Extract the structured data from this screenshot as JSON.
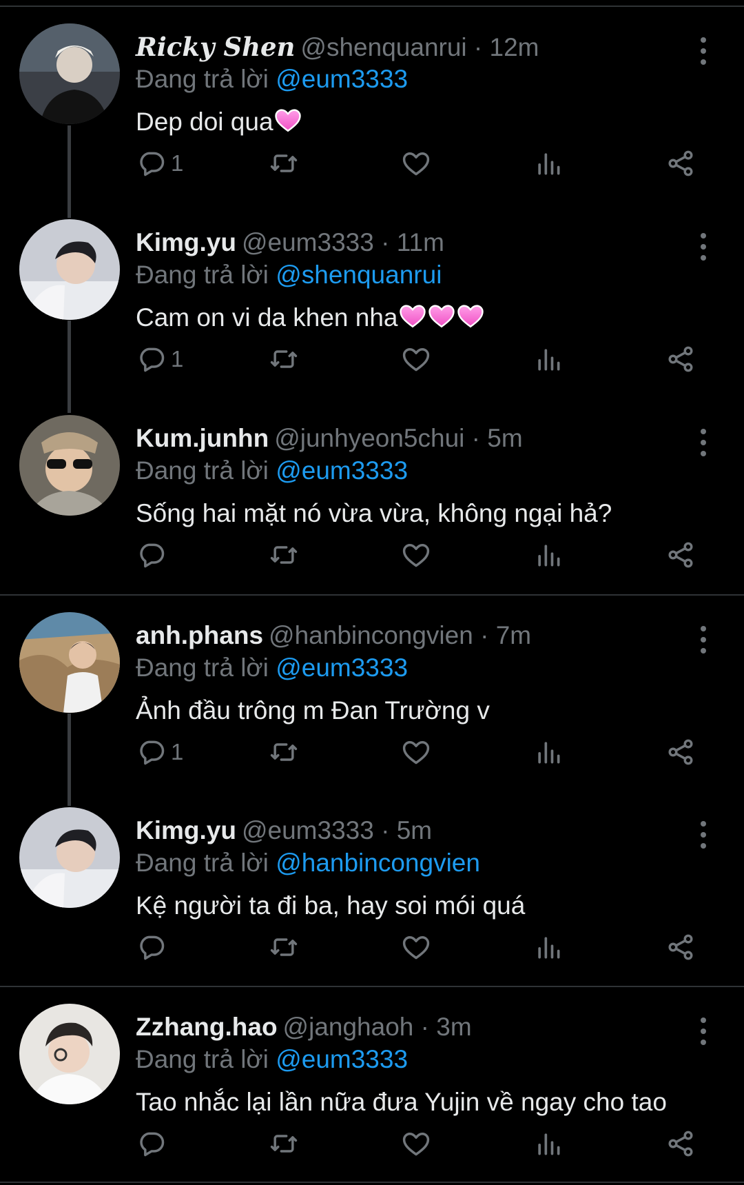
{
  "colors": {
    "background": "#000000",
    "text": "#e7e9ea",
    "muted": "#71767b",
    "mention": "#1d9bf0",
    "divider": "#2f3336"
  },
  "reply_prefix": "Đang trả lời",
  "tweets": [
    {
      "name": "Ricky Shen",
      "handle": "@shenquanrui · 12m",
      "reply_to": "@eum3333",
      "text": "Dep doi qua",
      "hearts": 1,
      "reply_count": "1"
    },
    {
      "name": "Kimg.yu",
      "handle": "@eum3333 · 11m",
      "reply_to": "@shenquanrui",
      "text": "Cam on vi da khen nha",
      "hearts": 3,
      "reply_count": "1"
    },
    {
      "name": "Kum.junhn",
      "handle": "@junhyeon5chui · 5m",
      "reply_to": "@eum3333",
      "text": "Sống hai mặt nó vừa vừa, không ngại hả?",
      "hearts": 0,
      "reply_count": ""
    },
    {
      "name": "anh.phans",
      "handle": "@hanbincongvien · 7m",
      "reply_to": "@eum3333",
      "text": "Ảnh đầu trông m Đan Trường v",
      "hearts": 0,
      "reply_count": "1"
    },
    {
      "name": "Kimg.yu",
      "handle": "@eum3333 · 5m",
      "reply_to": "@hanbincongvien",
      "text": "Kệ người ta đi ba, hay soi mói quá",
      "hearts": 0,
      "reply_count": ""
    },
    {
      "name": "Zzhang.hao",
      "handle": "@janghaoh · 3m",
      "reply_to": "@eum3333",
      "text": "Tao nhắc lại lần nữa đưa Yujin về ngay cho tao",
      "hearts": 0,
      "reply_count": ""
    }
  ],
  "icons": {
    "reply": "reply-icon",
    "retweet": "retweet-icon",
    "like": "like-icon",
    "views": "views-icon",
    "share": "share-icon",
    "more": "more-icon"
  }
}
